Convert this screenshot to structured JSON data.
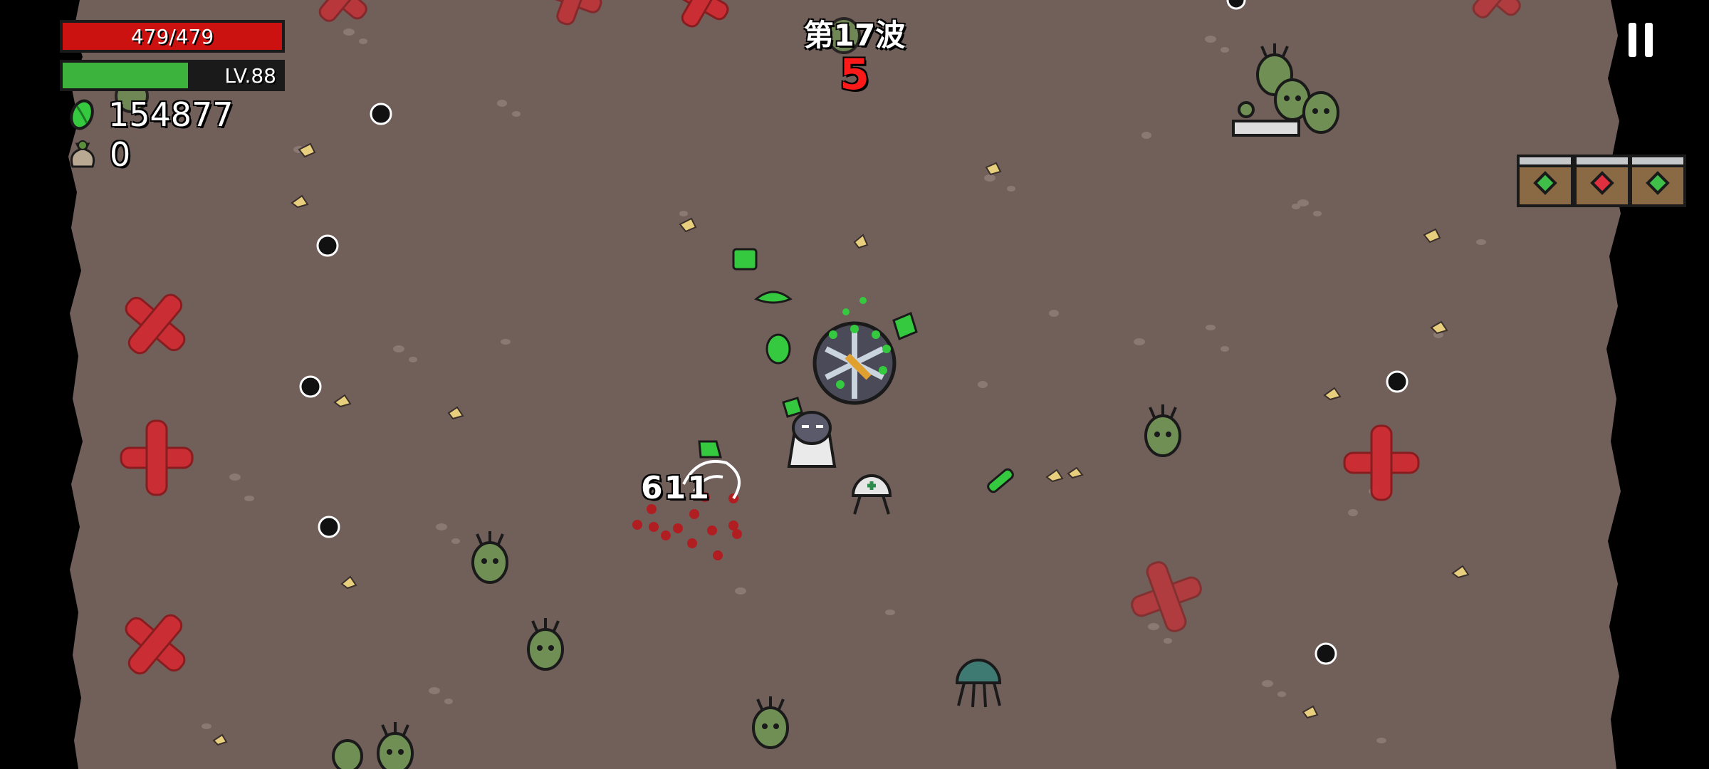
{
  "hud": {
    "health": {
      "text": "479/479",
      "current": 479,
      "max": 479,
      "color": "#cc1111"
    },
    "experience": {
      "level_text": "LV.88",
      "progress": 0.57,
      "color": "#3cb33c"
    },
    "materials": {
      "icon": "material-icon",
      "value": "154877"
    },
    "harvest_bag": {
      "icon": "bag-icon",
      "value": "0"
    }
  },
  "wave": {
    "title": "第17波",
    "timer": "5",
    "timer_color": "#ff1a1a"
  },
  "pause": {
    "icon": "pause-icon"
  },
  "combat": {
    "damage_number": "611"
  },
  "crates": [
    {
      "icon": "loot-crate-icon",
      "gem": "green"
    },
    {
      "icon": "loot-crate-icon",
      "gem": "red"
    },
    {
      "icon": "loot-crate-icon",
      "gem": "green"
    }
  ],
  "colors": {
    "ground": "#715f5a",
    "hp_fill": "#cc1111",
    "xp_fill": "#3cb33c",
    "enemy_green": "#6f8f55",
    "spawn_marker": "#d02b33",
    "material_green": "#34c93e"
  }
}
